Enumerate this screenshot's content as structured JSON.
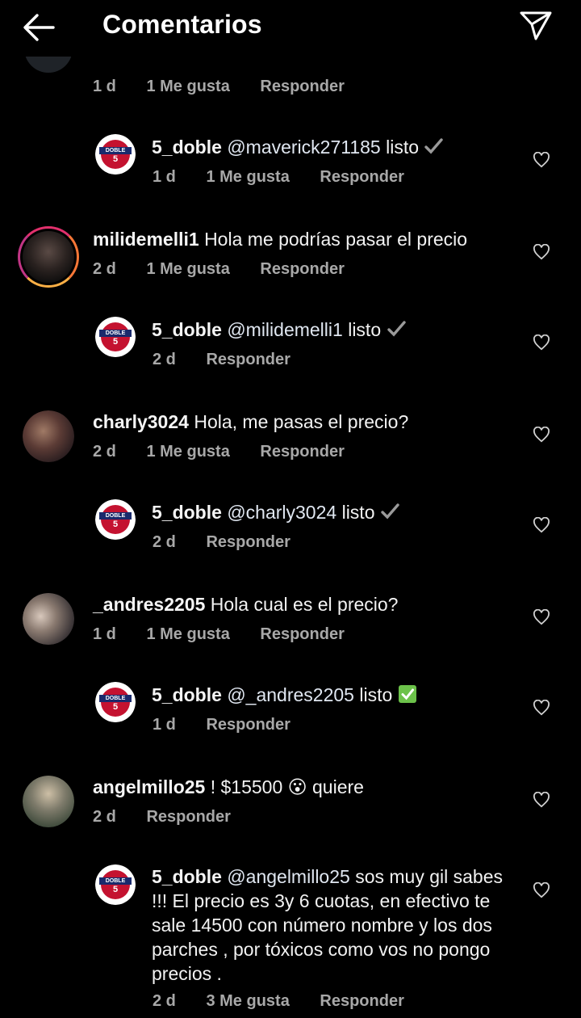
{
  "header": {
    "title": "Comentarios"
  },
  "top_partial": {
    "time": "1 d",
    "likes": "1 Me gusta",
    "reply": "Responder"
  },
  "comments": [
    {
      "username": "5_doble",
      "mention": "@maverick271185",
      "text": "listo",
      "check": "gray-check",
      "time": "1 d",
      "likes": "1 Me gusta",
      "reply": "Responder"
    },
    {
      "username": "milidemelli1",
      "mention": "",
      "text": "Hola me podrías pasar el precio",
      "time": "2 d",
      "likes": "1 Me gusta",
      "reply": "Responder"
    },
    {
      "username": "5_doble",
      "mention": "@milidemelli1",
      "text": "listo",
      "check": "gray-check",
      "time": "2 d",
      "likes": "",
      "reply": "Responder"
    },
    {
      "username": "charly3024",
      "mention": "",
      "text": "Hola, me pasas el precio?",
      "time": "2 d",
      "likes": "1 Me gusta",
      "reply": "Responder"
    },
    {
      "username": "5_doble",
      "mention": "@charly3024",
      "text": "listo",
      "check": "gray-check",
      "time": "2 d",
      "likes": "",
      "reply": "Responder"
    },
    {
      "username": "_andres2205",
      "mention": "",
      "text": "Hola cual es el precio?",
      "time": "1 d",
      "likes": "1 Me gusta",
      "reply": "Responder"
    },
    {
      "username": "5_doble",
      "mention": "@_andres2205",
      "text": "listo",
      "check": "green-check",
      "time": "1 d",
      "likes": "",
      "reply": "Responder"
    },
    {
      "username": "angelmillo25",
      "mention": "",
      "text": "! $15500",
      "emoji": "😮",
      "text2": "quiere",
      "time": "2 d",
      "likes": "",
      "reply": "Responder"
    },
    {
      "username": "5_doble",
      "mention": "@angelmillo25",
      "text": "sos muy gil sabes !!! El precio es 3y 6 cuotas, en efectivo te sale  14500 con número nombre y los dos parches , por tóxicos como vos no pongo precios .",
      "time": "2 d",
      "likes": "3 Me gusta",
      "reply": "Responder"
    }
  ],
  "logo": {
    "band": "DOBLE",
    "num": "5"
  },
  "colors": {
    "background": "#000000",
    "meta": "#a8a8a8",
    "logo_red": "#c41230",
    "logo_navy": "#1a2a6c"
  }
}
